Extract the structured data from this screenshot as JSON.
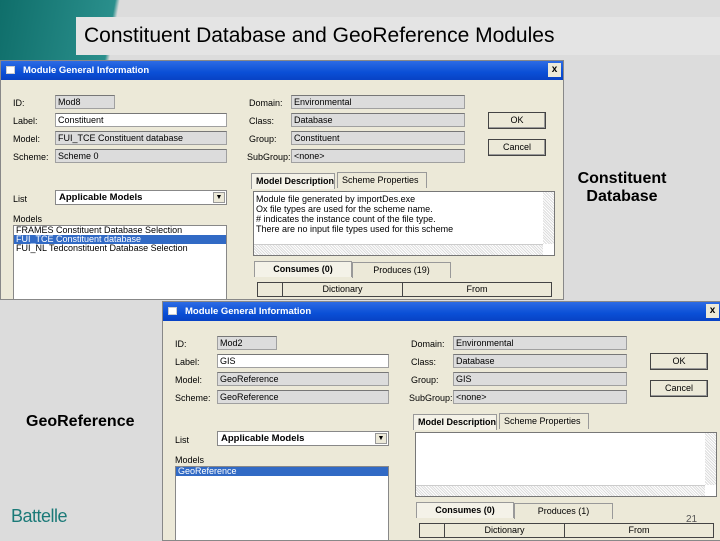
{
  "slide": {
    "title": "Constituent Database and GeoReference Modules",
    "caption_top": "Constituent Database",
    "caption_bottom": "GeoReference",
    "logo": "Battelle",
    "page_number": "21"
  },
  "dialogs": [
    {
      "title": "Module General Information",
      "close": "x",
      "labels": {
        "id": "ID:",
        "label": "Label:",
        "model": "Model:",
        "scheme": "Scheme:",
        "list": "List",
        "models": "Models",
        "domain": "Domain:",
        "class": "Class:",
        "group": "Group:",
        "subgroup": "SubGroup:"
      },
      "values": {
        "id": "Mod8",
        "label": "Constituent",
        "model": "FUI_TCE Constituent database",
        "scheme": "Scheme 0",
        "domain": "Environmental",
        "class": "Database",
        "group": "Constituent",
        "subgroup": "<none>"
      },
      "list_select": "Applicable Models",
      "models": [
        "FRAMES Constituent Database Selection",
        "FUI_TCE Constituent database",
        "FUI_NL Tedconstituent Database Selection"
      ],
      "ok": "OK",
      "cancel": "Cancel",
      "tabs": [
        "Model Description",
        "Scheme Properties"
      ],
      "description": [
        "Module file generated by importDes.exe",
        "Ox file types are used for the scheme name.",
        "# indicates the instance count of the file type.",
        "There are no input file types used for this scheme"
      ],
      "subtabs": [
        "Consumes (0)",
        "Produces (19)"
      ],
      "columns": [
        "",
        "Dictionary",
        "From"
      ]
    },
    {
      "title": "Module General Information",
      "close": "x",
      "labels": {
        "id": "ID:",
        "label": "Label:",
        "model": "Model:",
        "scheme": "Scheme:",
        "list": "List",
        "models": "Models",
        "domain": "Domain:",
        "class": "Class:",
        "group": "Group:",
        "subgroup": "SubGroup:"
      },
      "values": {
        "id": "Mod2",
        "label": "GIS",
        "model": "GeoReference",
        "scheme": "GeoReference",
        "domain": "Environmental",
        "class": "Database",
        "group": "GIS",
        "subgroup": "<none>"
      },
      "list_select": "Applicable Models",
      "models": [
        "GeoReference"
      ],
      "ok": "OK",
      "cancel": "Cancel",
      "tabs": [
        "Model Description",
        "Scheme Properties"
      ],
      "description": [],
      "subtabs": [
        "Consumes (0)",
        "Produces (1)"
      ],
      "columns": [
        "",
        "Dictionary",
        "From"
      ]
    }
  ]
}
